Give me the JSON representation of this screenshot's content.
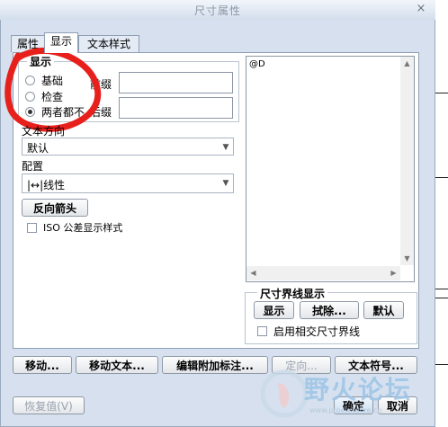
{
  "dialog": {
    "title": "尺寸属性",
    "close_glyph": "×"
  },
  "tabs": [
    {
      "label": "属性"
    },
    {
      "label": "显示"
    },
    {
      "label": "文本样式"
    }
  ],
  "display_group": {
    "legend": "显示",
    "options": [
      "基础",
      "检查",
      "两者都不"
    ],
    "selected": "两者都不",
    "prefix_label": "前缀",
    "prefix_value": "",
    "suffix_label": "后缀",
    "suffix_value": ""
  },
  "text_direction": {
    "label": "文本方向",
    "value": "默认"
  },
  "config": {
    "label": "配置",
    "value": "|↔|线性"
  },
  "reverse_arrow_button": "反向箭头",
  "iso_checkbox": {
    "label": "ISO 公差显示样式",
    "checked": false
  },
  "text_area": {
    "value": "@D"
  },
  "extension_group": {
    "legend": "尺寸界线显示",
    "show_button": "显示",
    "erase_button": "拭除...",
    "default_button": "默认",
    "intersect_checkbox_label": "启用相交尺寸界线",
    "intersect_checked": false
  },
  "bottom_buttons": {
    "move": "移动...",
    "move_text": "移动文本...",
    "edit_attachment": "编辑附加标注...",
    "orient": "定向...",
    "text_symbol": "文本符号..."
  },
  "footer": {
    "restore": "恢复值(V)",
    "ok": "确定",
    "cancel": "取消"
  },
  "watermark": {
    "brand": "野火论坛",
    "url": "www.proewildfire.cn"
  },
  "colors": {
    "annotation_red": "#e8201c"
  }
}
